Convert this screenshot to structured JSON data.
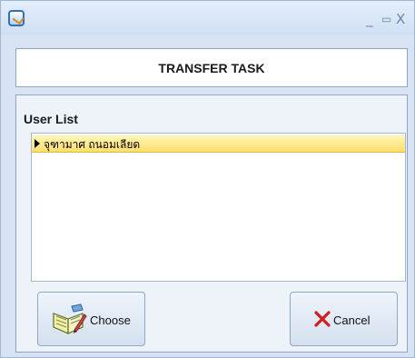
{
  "window": {
    "controls": {
      "minimize": "_",
      "maximize": "▭",
      "close": "X"
    }
  },
  "header": {
    "title": "TRANSFER TASK"
  },
  "user_list": {
    "title": "User List",
    "items": [
      {
        "label": "จุฑามาศ ถนอมเลียด"
      }
    ]
  },
  "buttons": {
    "choose_label": "Choose",
    "cancel_label": "Cancel"
  },
  "colors": {
    "selected_row": "#ffde6b",
    "cancel_x": "#d21e1e",
    "accent": "#2f6fbf"
  },
  "icons": {
    "app": "app-icon",
    "choose": "open-book-pen-icon",
    "cancel": "red-x-icon"
  }
}
